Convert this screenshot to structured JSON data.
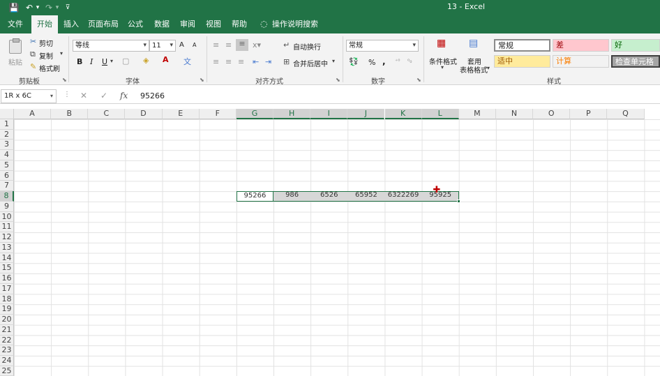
{
  "window": {
    "title": "13  -  Excel"
  },
  "quick_access": [
    {
      "name": "save-icon",
      "glyph": "💾"
    },
    {
      "name": "undo-icon",
      "glyph": "↶"
    },
    {
      "name": "undo-dropdown-icon",
      "glyph": "▾"
    },
    {
      "name": "redo-icon",
      "glyph": "↷"
    },
    {
      "name": "redo-dropdown-icon",
      "glyph": "▾"
    },
    {
      "name": "customize-qat-icon",
      "glyph": "⊽"
    }
  ],
  "menu": [
    "文件",
    "开始",
    "插入",
    "页面布局",
    "公式",
    "数据",
    "审阅",
    "视图",
    "帮助"
  ],
  "tell_me": "操作说明搜索",
  "ribbon": {
    "clipboard": {
      "label": "剪贴板",
      "paste": "粘贴",
      "cut": "剪切",
      "copy": "复制",
      "format_painter": "格式刷"
    },
    "font": {
      "label": "字体",
      "font_name": "等线",
      "font_size": "11",
      "grow": "A",
      "shrink": "A",
      "bold": "B",
      "italic": "I",
      "underline": "U"
    },
    "alignment": {
      "label": "对齐方式",
      "wrap_text": "自动换行",
      "merge_center": "合并后居中"
    },
    "number": {
      "label": "数字",
      "format": "常规",
      "percent": "%",
      "comma": ","
    },
    "styles": {
      "label": "样式",
      "conditional_format": "条件格式",
      "format_as_table_1": "套用",
      "format_as_table_2": "表格格式",
      "cells": [
        {
          "text": "常规",
          "color": "#222222",
          "bg": "#ffffff"
        },
        {
          "text": "差",
          "color": "#9c0006",
          "bg": "#ffc7ce"
        },
        {
          "text": "好",
          "color": "#006100",
          "bg": "#c6efce"
        },
        {
          "text": "适中",
          "color": "#9c5700",
          "bg": "#ffeb9c"
        },
        {
          "text": "计算",
          "color": "#fa7d00",
          "bg": "#f2f2f2"
        },
        {
          "text": "检查单元格",
          "color": "#ffffff",
          "bg": "#a5a5a5"
        }
      ]
    }
  },
  "formula_bar": {
    "name_box": "1R x 6C",
    "fx": "fx",
    "formula": "95266"
  },
  "columns": [
    "A",
    "B",
    "C",
    "D",
    "E",
    "F",
    "G",
    "H",
    "I",
    "J",
    "K",
    "L",
    "M",
    "N",
    "O",
    "P",
    "Q"
  ],
  "rows": [
    "1",
    "2",
    "3",
    "4",
    "5",
    "6",
    "7",
    "8",
    "9",
    "10",
    "11",
    "12",
    "13",
    "14",
    "15",
    "16",
    "17",
    "18",
    "19",
    "20",
    "21",
    "22",
    "23",
    "24",
    "25"
  ],
  "selected_columns": [
    "G",
    "H",
    "I",
    "J",
    "K",
    "L"
  ],
  "selected_row": "8",
  "row8_values": [
    "95266",
    "986",
    "6526",
    "65952",
    "6322269",
    "95925"
  ],
  "colors": {
    "brand": "#217346",
    "selection": "#d7d7d7"
  }
}
